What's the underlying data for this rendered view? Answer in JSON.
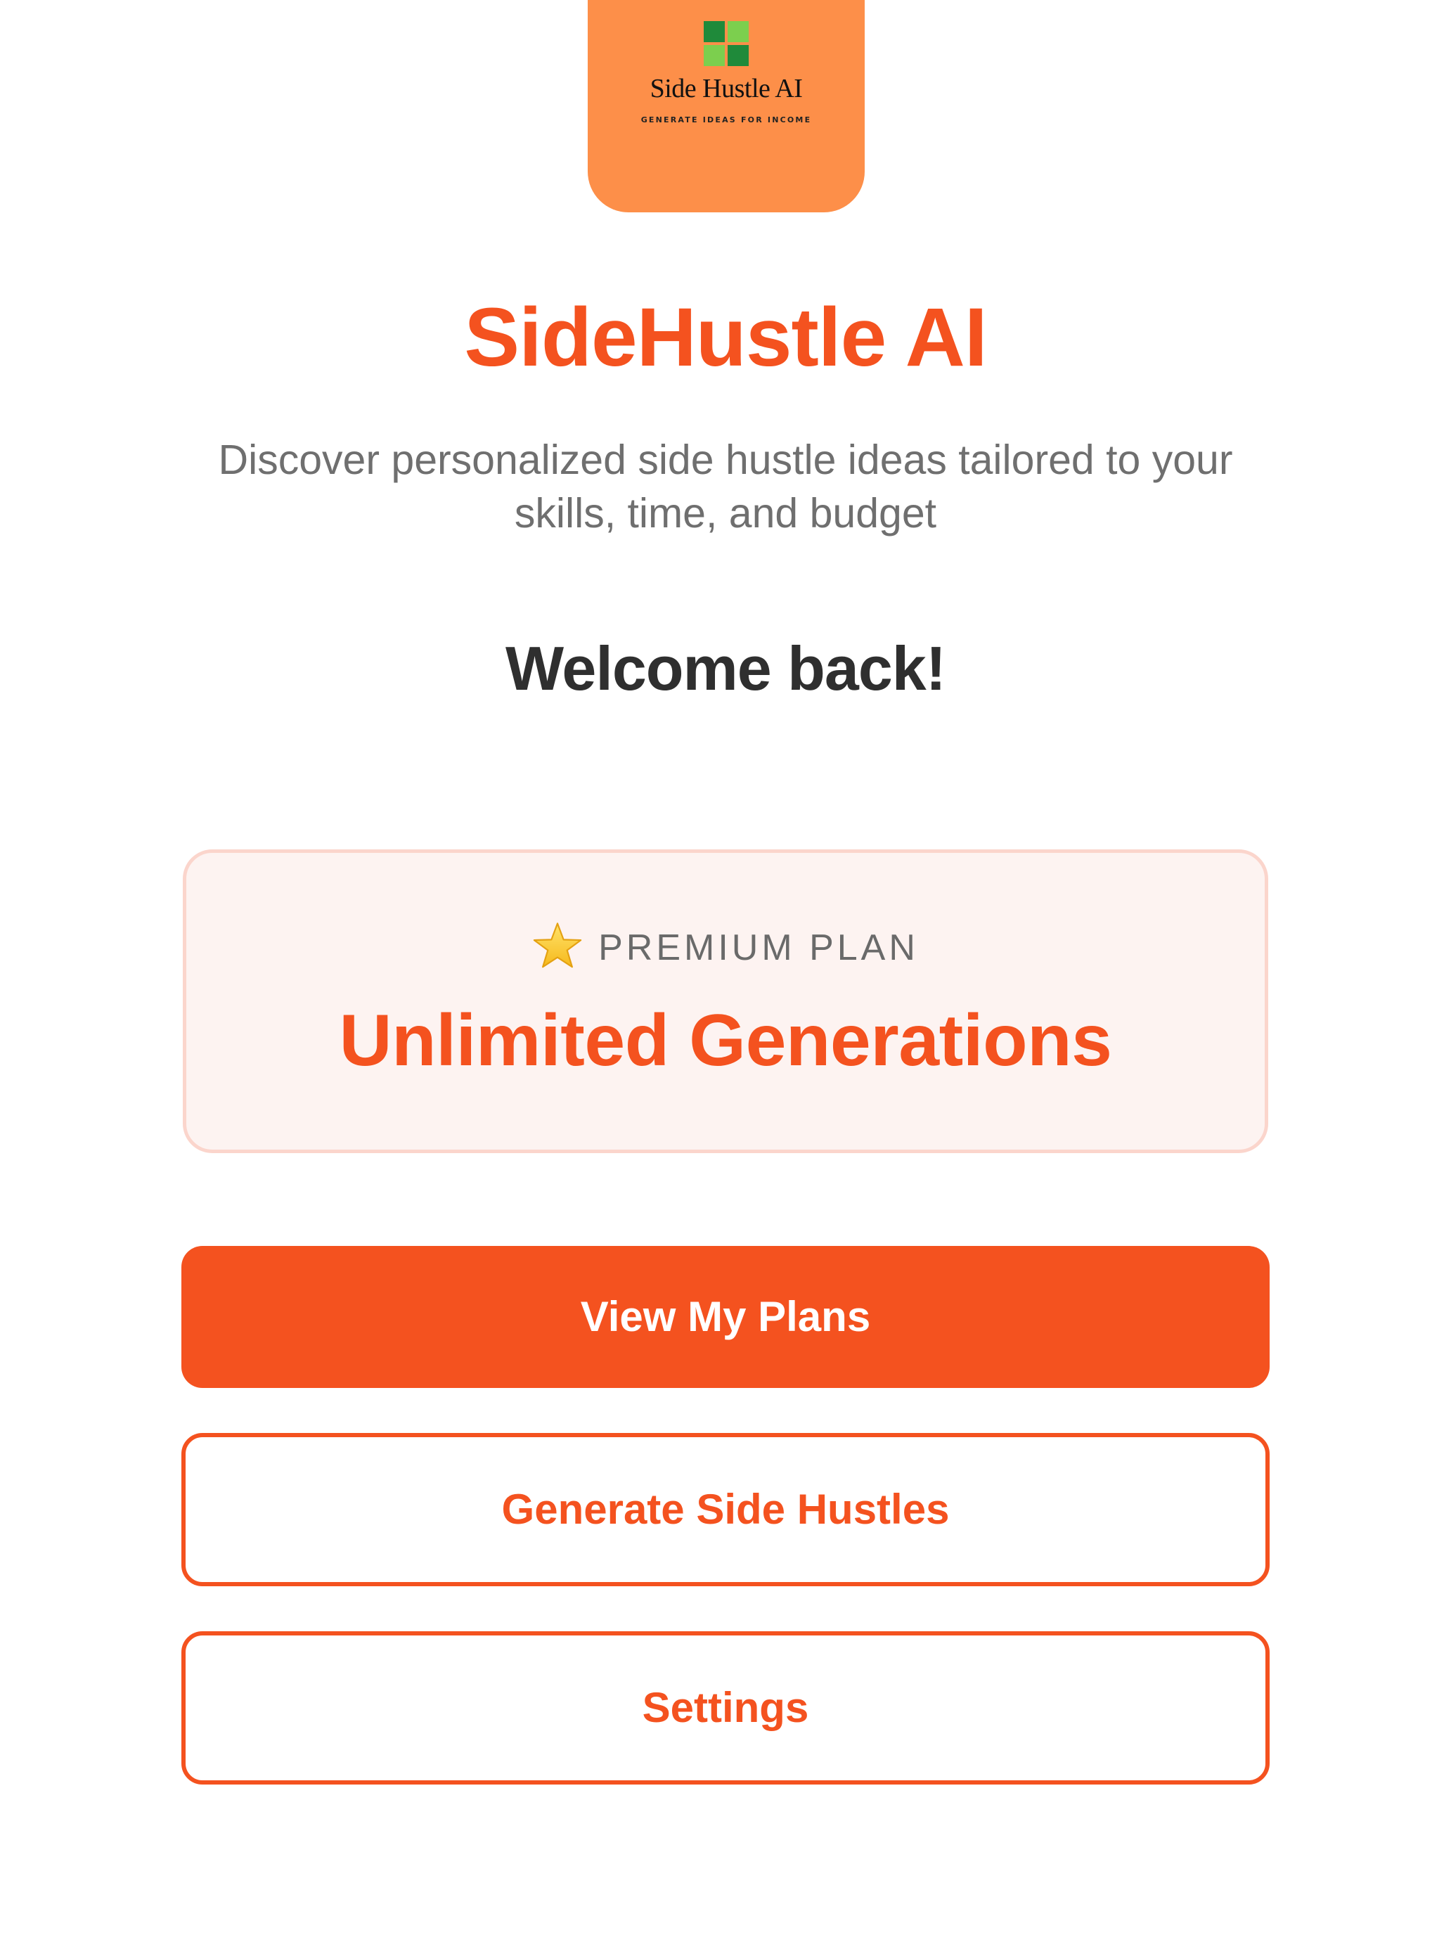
{
  "logo": {
    "name": "Side Hustle AI",
    "tagline": "GENERATE IDEAS FOR INCOME",
    "icon": "app-logo-icon",
    "colors": {
      "tile": "#fd8f49",
      "mark_dark": "#1f8a3a",
      "mark_light": "#7ccf4e"
    }
  },
  "header": {
    "title": "SideHustle AI",
    "subtitle": "Discover personalized side hustle ideas tailored to your skills, time, and budget"
  },
  "welcome": {
    "text": "Welcome back!"
  },
  "plan_card": {
    "icon": "star-icon",
    "label": "PREMIUM PLAN",
    "headline": "Unlimited Generations"
  },
  "actions": {
    "view_plans": "View My Plans",
    "generate": "Generate Side Hustles",
    "settings": "Settings"
  },
  "colors": {
    "accent": "#f4521f",
    "card_bg": "#fdf3f1",
    "card_border": "#fbd5cc",
    "subtitle": "#6f6f6f",
    "heading": "#2f2f2f"
  }
}
